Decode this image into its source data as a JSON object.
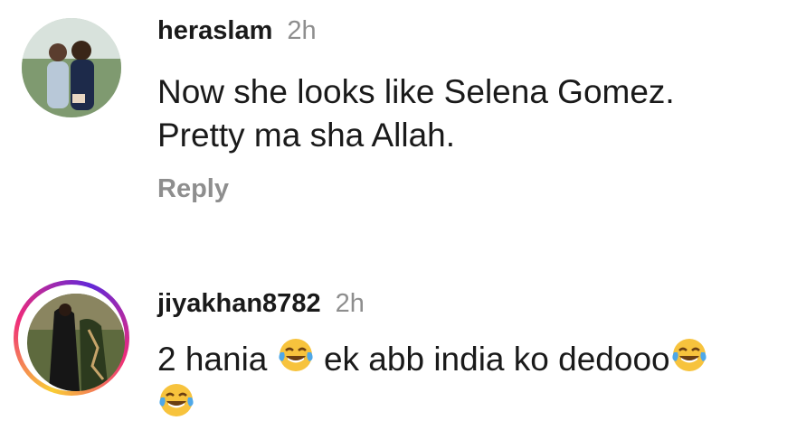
{
  "comments": [
    {
      "username": "heraslam",
      "time": "2h",
      "text_line1": "Now she looks like Selena Gomez.",
      "text_line2": "Pretty ma sha Allah.",
      "reply_label": "Reply"
    },
    {
      "username": "jiyakhan8782",
      "time": "2h",
      "text_part1": "2 hania",
      "text_part2": "ek abb india ko dedooo",
      "emoji_name": "face-with-tears-of-joy-icon"
    }
  ],
  "colors": {
    "text": "#1a1a1a",
    "muted": "#8e8e8e",
    "story_ring_start": "#f9ce34",
    "story_ring_mid": "#ee2a7b",
    "story_ring_end": "#6228d7"
  }
}
